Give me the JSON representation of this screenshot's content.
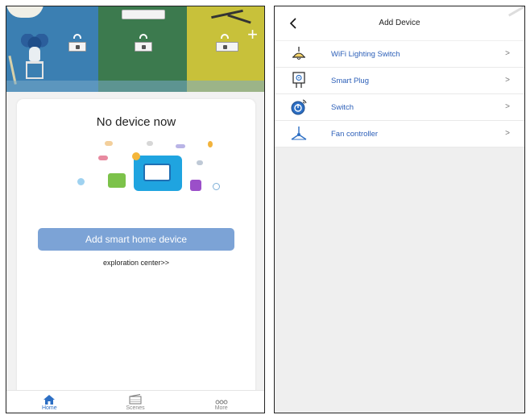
{
  "left": {
    "card_title": "No device now",
    "add_button_label": "Add smart home device",
    "explore_link": "exploration center>>",
    "tabs": [
      {
        "label": "Home",
        "icon": "home-icon",
        "active": true
      },
      {
        "label": "Scenes",
        "icon": "scenes-icon",
        "active": false
      },
      {
        "label": "More",
        "icon": "more-icon",
        "active": false
      }
    ],
    "colors": {
      "accent": "#2d6fc4",
      "button": "#7ca3d6"
    }
  },
  "right": {
    "back_icon": "chevron-left-icon",
    "title": "Add Device",
    "devices": [
      {
        "label": "WiFi Lighting Switch",
        "icon": "ceiling-lamp-icon",
        "chevron": ">"
      },
      {
        "label": "Smart Plug",
        "icon": "smart-plug-icon",
        "chevron": ">"
      },
      {
        "label": "Switch",
        "icon": "power-switch-icon",
        "chevron": ">"
      },
      {
        "label": "Fan controller",
        "icon": "ceiling-fan-icon",
        "chevron": ">"
      }
    ],
    "colors": {
      "label": "#2c5fb8"
    }
  }
}
